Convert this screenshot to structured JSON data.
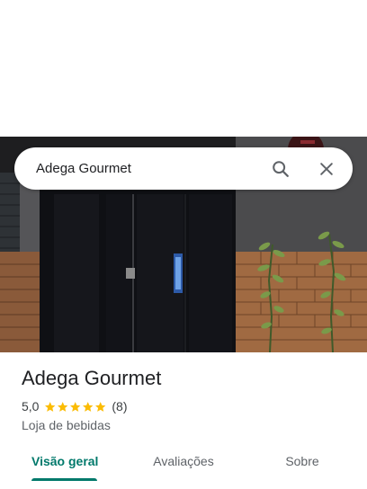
{
  "search": {
    "query": "Adega Gourmet"
  },
  "place": {
    "name": "Adega Gourmet",
    "rating": "5,0",
    "rating_value": 5,
    "reviews_count": "(8)",
    "category": "Loja de bebidas"
  },
  "tabs": [
    {
      "label": "Visão geral",
      "active": true
    },
    {
      "label": "Avaliações",
      "active": false
    },
    {
      "label": "Sobre",
      "active": false
    }
  ],
  "colors": {
    "accent": "#00796b",
    "star": "#fbbc04",
    "title_text": "#202124",
    "secondary_text": "#5f6368"
  },
  "icons": {
    "search": "search-icon",
    "close": "close-icon",
    "star": "star-icon"
  }
}
